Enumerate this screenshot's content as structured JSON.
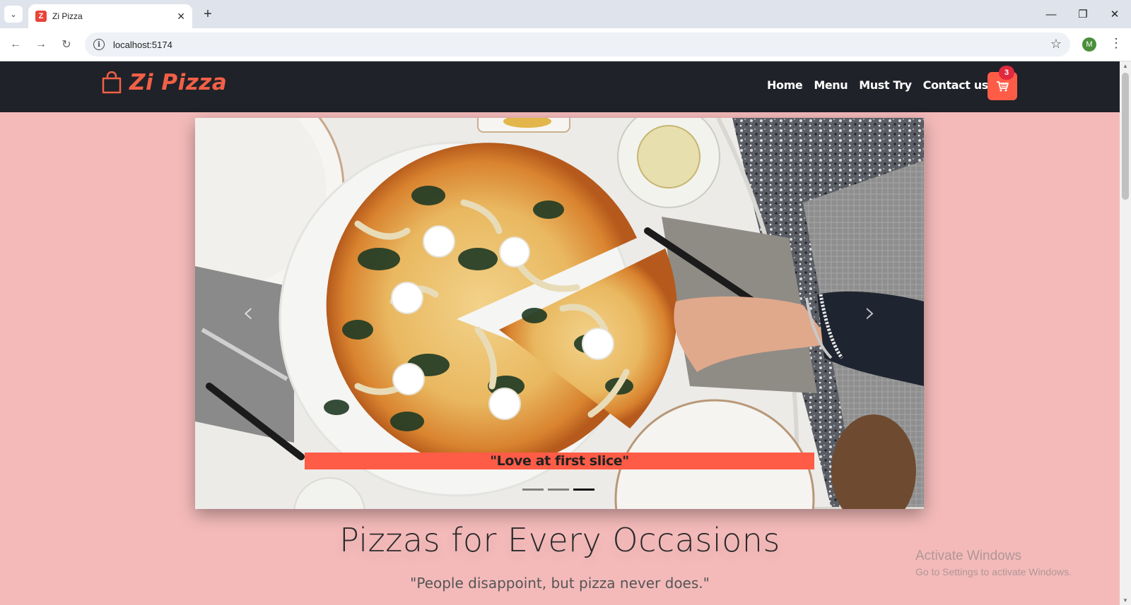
{
  "browser": {
    "tab_title": "Zi Pizza",
    "favicon_letter": "Z",
    "url": "localhost:5174",
    "profile_initial": "M"
  },
  "site": {
    "brand": "Zi Pizza",
    "nav": [
      {
        "label": "Home"
      },
      {
        "label": "Menu"
      },
      {
        "label": "Must Try"
      },
      {
        "label": "Contact us"
      }
    ],
    "cart_count": "3"
  },
  "carousel": {
    "caption": "\"Love at first slice\"",
    "slides_total": 3,
    "active_slide": 3
  },
  "hero": {
    "headline": "Pizzas for Every Occasions",
    "quote": "\"People disappoint, but pizza never does.\""
  },
  "watermark": {
    "line1": "Activate Windows",
    "line2": "Go to Settings to activate Windows."
  },
  "colors": {
    "page_bg": "#f4baba",
    "nav_bg": "#1f2228",
    "accent": "#ff5c47",
    "brand": "#f26047",
    "badge": "#e1293f"
  }
}
